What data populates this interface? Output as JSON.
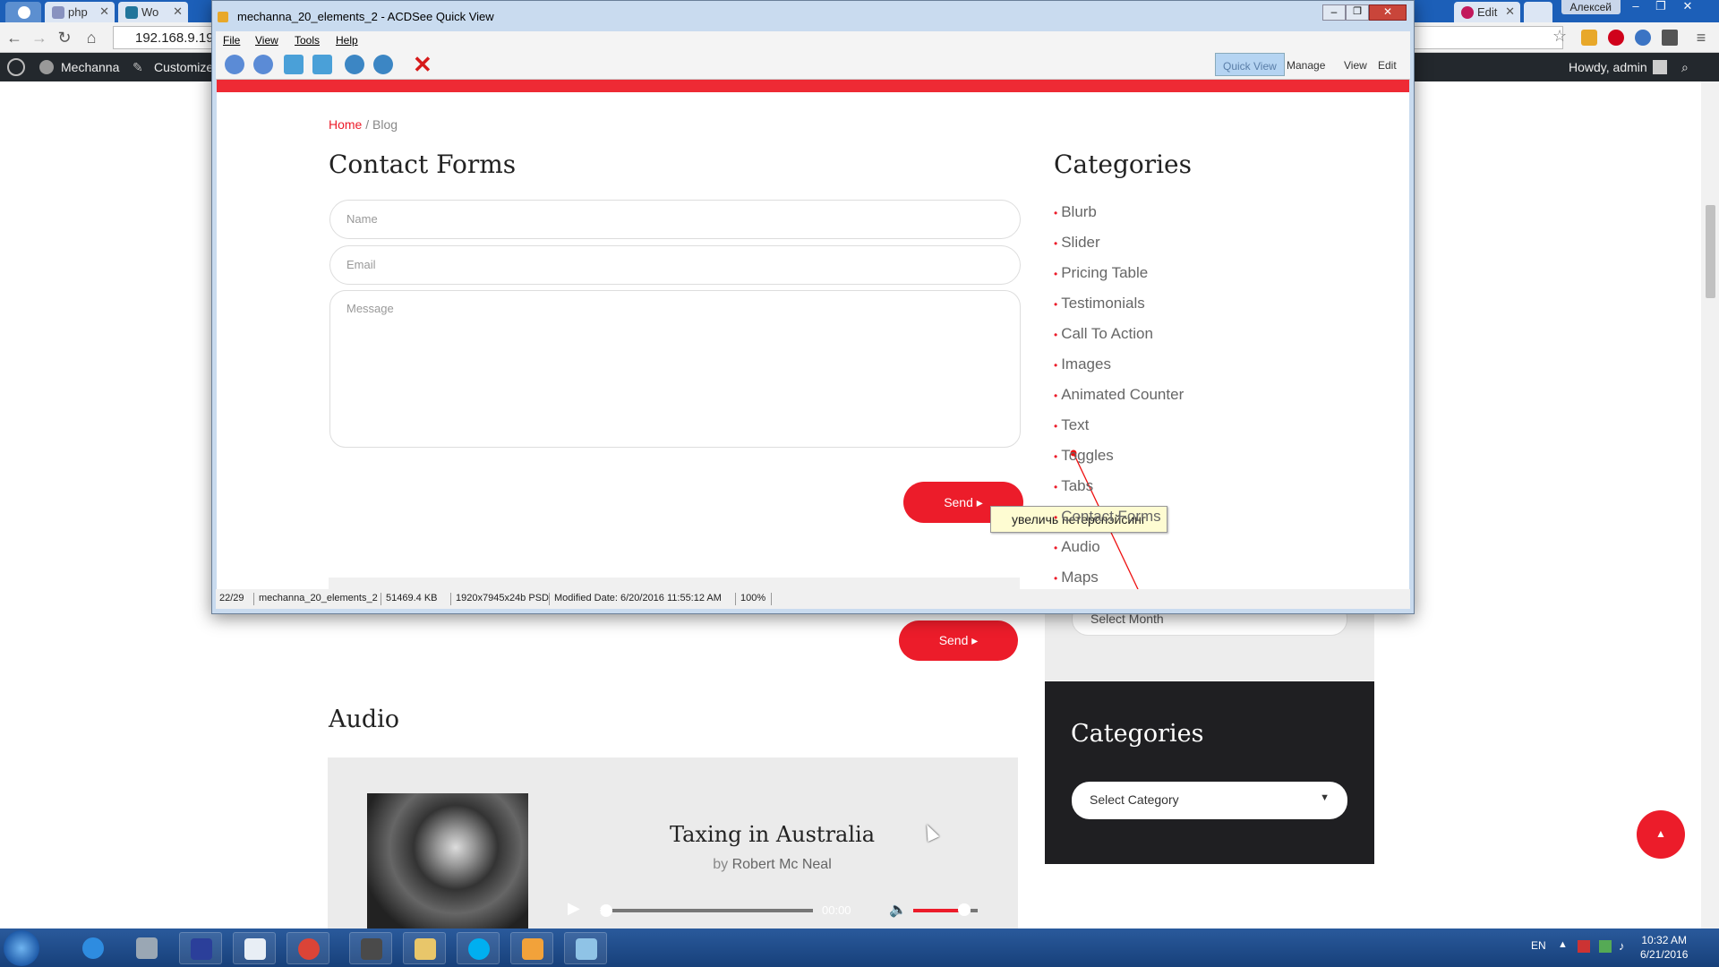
{
  "browser": {
    "tabs": [
      {
        "label": "php",
        "color": "#8892bf"
      },
      {
        "label": "Wo",
        "color": "#21759b"
      },
      {
        "label": "Edit",
        "color": "#c2185b"
      }
    ],
    "user": "Алексей",
    "url": "192.168.9.19"
  },
  "wp_admin_bar": {
    "site": "Mechanna",
    "customize": "Customize",
    "howdy": "Howdy, admin"
  },
  "acdsee": {
    "title": "mechanna_20_elements_2 - ACDSee Quick View",
    "menu": [
      "File",
      "View",
      "Tools",
      "Help"
    ],
    "modes": [
      "Quick View",
      "Manage",
      "View",
      "Edit"
    ],
    "status": {
      "index": "22/29",
      "filename": "mechanna_20_elements_2",
      "size": "51469.4 KB",
      "dims": "1920x7945x24b PSD",
      "modified": "Modified Date: 6/20/2016 11:55:12 AM",
      "zoom": "100%"
    }
  },
  "mockup": {
    "breadcrumb_home": "Home",
    "breadcrumb_sep": " / ",
    "breadcrumb_current": "Blog",
    "title": "Contact Forms",
    "name_placeholder": "Name",
    "email_placeholder": "Email",
    "message_placeholder": "Message",
    "send_label": "Send",
    "categories_title": "Categories",
    "categories": [
      "Blurb",
      "Slider",
      "Pricing Table",
      "Testimonials",
      "Call To Action",
      "Images",
      "Animated Counter",
      "Text",
      "Toggles",
      "Tabs",
      "Contact Forms",
      "Audio",
      "Maps"
    ],
    "note": "увеличь петерспэйсинг"
  },
  "page": {
    "send_label": "Send",
    "audio_title": "Audio",
    "track_title": "Taxing in Australia",
    "track_by": "by ",
    "track_author": "Robert Mc Neal",
    "time": "00:00",
    "select_month": "Select Month",
    "categories_title": "Categories",
    "select_category": "Select Category"
  },
  "taskbar": {
    "lang": "EN",
    "time": "10:32 AM",
    "date": "6/21/2016"
  },
  "colors": {
    "accent": "#ec1c2a",
    "wpbar": "#23282d",
    "taskbar": "#1f4c8a"
  }
}
